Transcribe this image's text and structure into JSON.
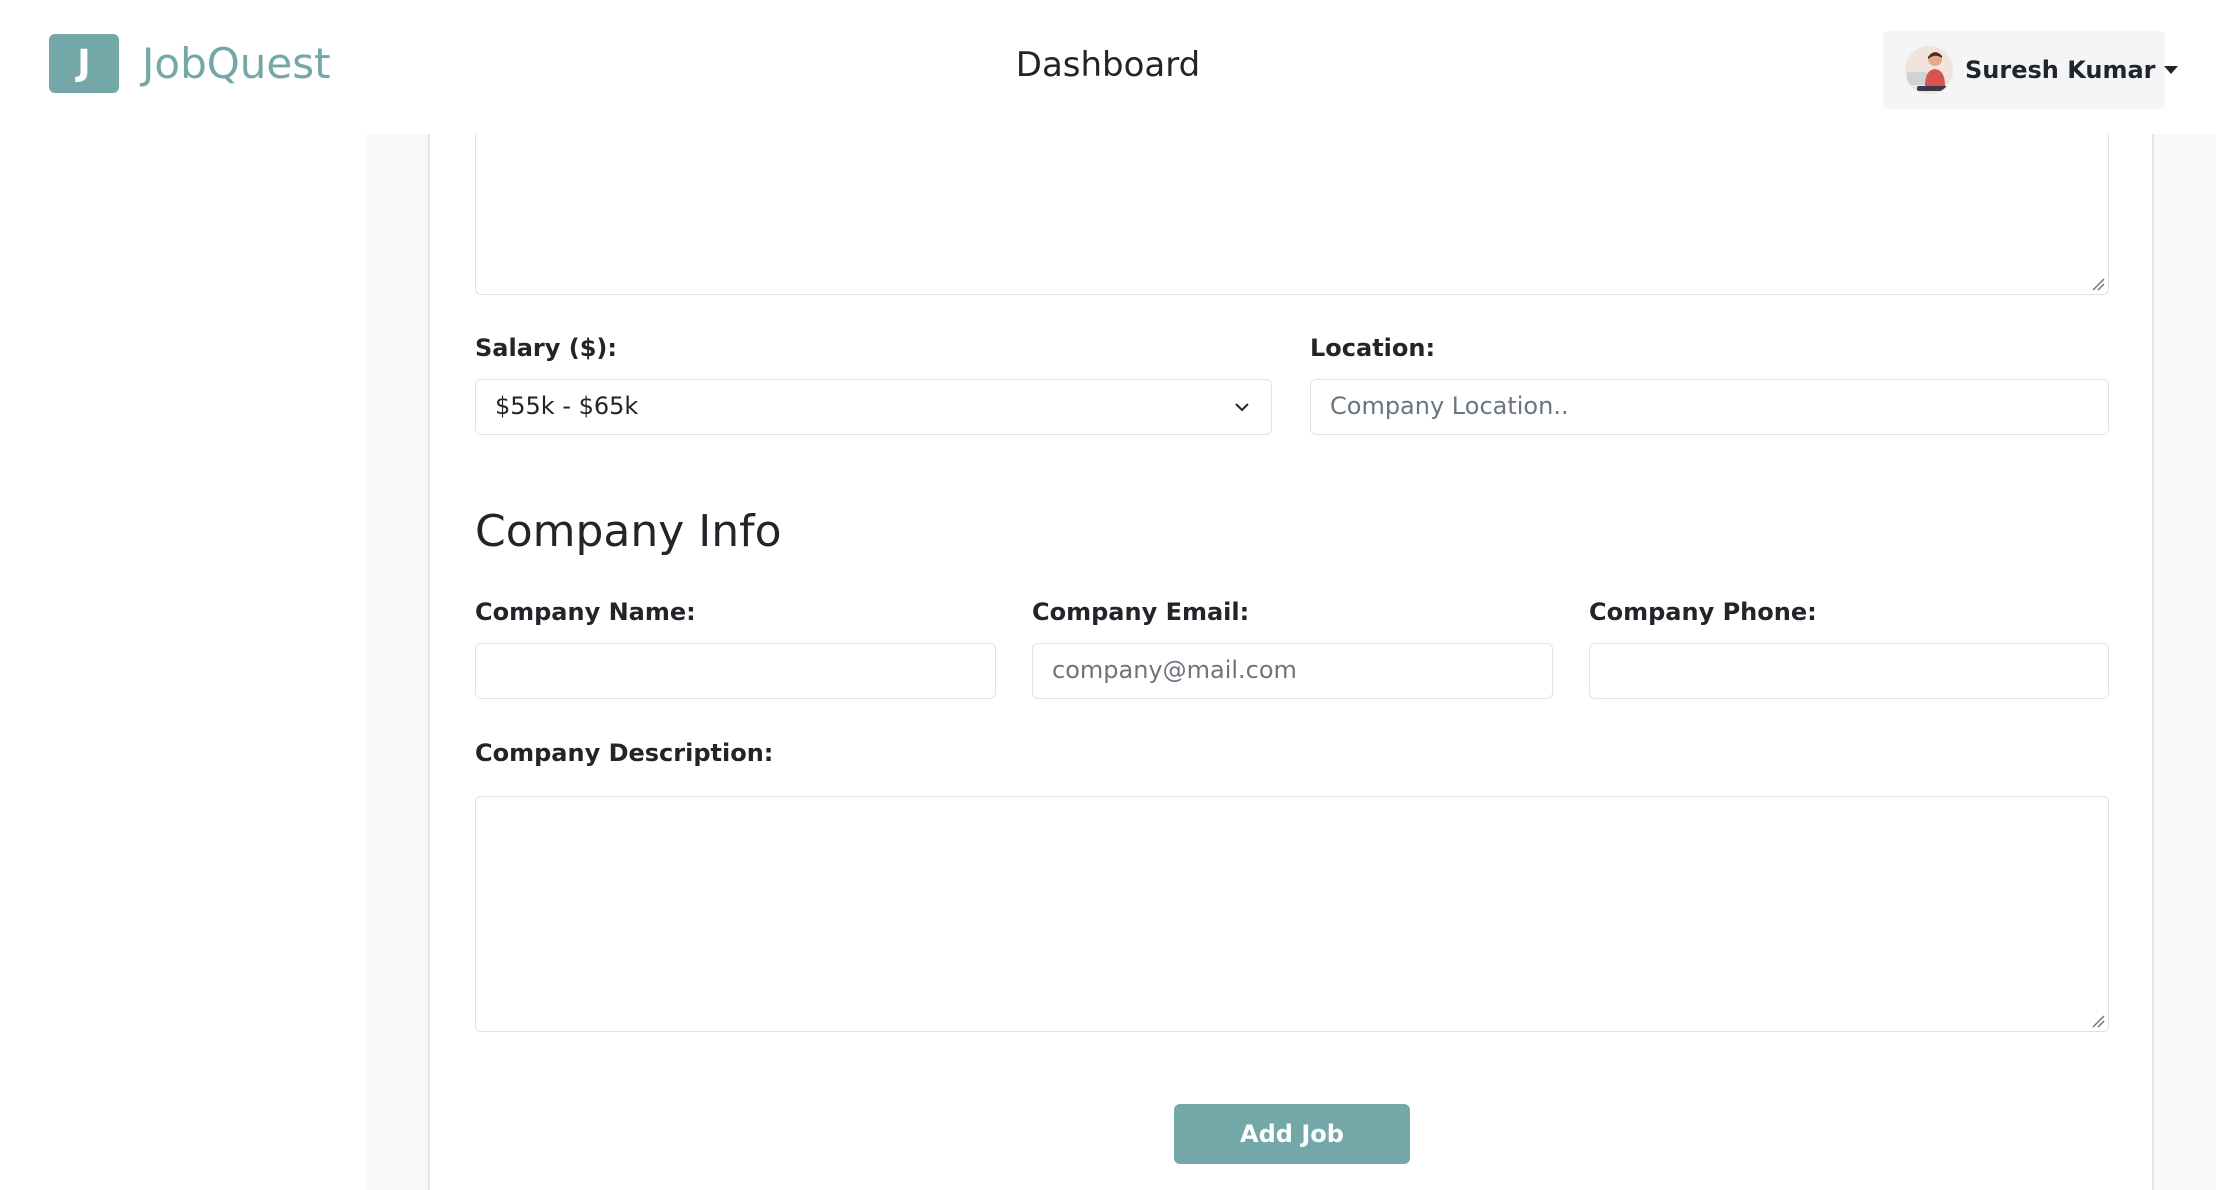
{
  "header": {
    "logo_letter": "J",
    "app_name": "JobQuest",
    "page_title": "Dashboard",
    "user_name": "Suresh Kumar"
  },
  "form": {
    "salary_label": "Salary ($):",
    "salary_value": "$55k - $65k",
    "location_label": "Location:",
    "location_placeholder": "Company Location..",
    "company_section_title": "Company Info",
    "company_name_label": "Company Name:",
    "company_name_value": "",
    "company_email_label": "Company Email:",
    "company_email_placeholder": "company@mail.com",
    "company_phone_label": "Company Phone:",
    "company_phone_value": "",
    "company_description_label": "Company Description:",
    "submit_label": "Add Job"
  },
  "colors": {
    "accent": "#74a8a8",
    "border": "#dee2e6",
    "page_background": "#f7f8f9"
  }
}
